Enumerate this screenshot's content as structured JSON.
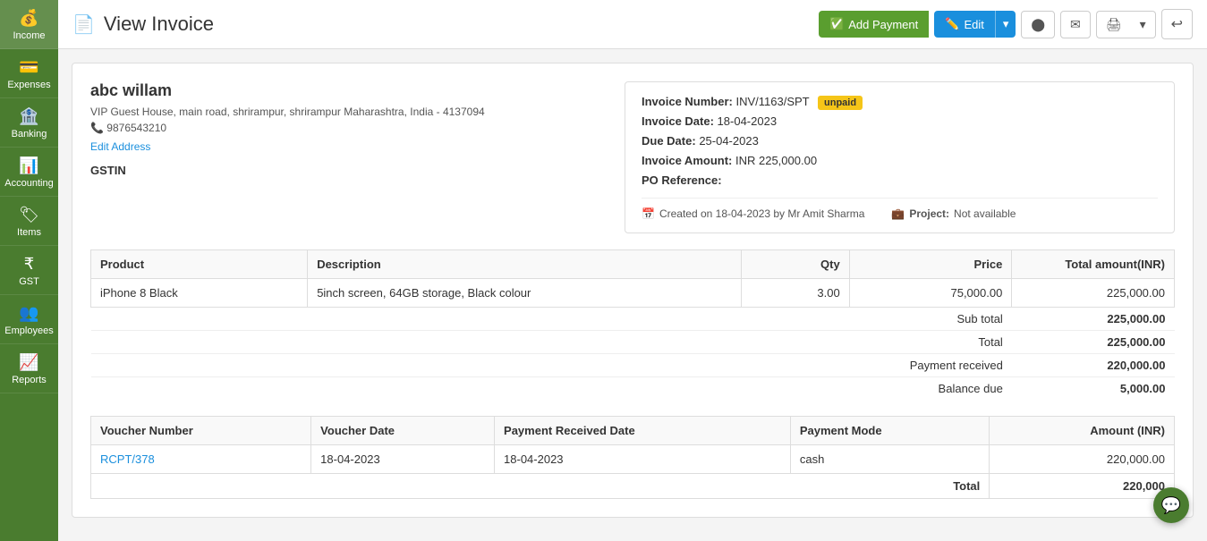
{
  "sidebar": {
    "items": [
      {
        "id": "income",
        "label": "Income",
        "icon": "💰"
      },
      {
        "id": "expenses",
        "label": "Expenses",
        "icon": "💳"
      },
      {
        "id": "banking",
        "label": "Banking",
        "icon": "🏦"
      },
      {
        "id": "accounting",
        "label": "Accounting",
        "icon": "📊"
      },
      {
        "id": "items",
        "label": "Items",
        "icon": "🏷"
      },
      {
        "id": "gst",
        "label": "GST",
        "icon": "₹"
      },
      {
        "id": "employees",
        "label": "Employees",
        "icon": "👥"
      },
      {
        "id": "reports",
        "label": "Reports",
        "icon": "📈"
      }
    ]
  },
  "header": {
    "page_icon": "📄",
    "title": "View Invoice",
    "buttons": {
      "add_payment": "Add Payment",
      "edit": "Edit",
      "back": "↩"
    }
  },
  "client": {
    "name": "abc willam",
    "address": "VIP Guest House, main road, shrirampur, shrirampur Maharashtra, India - 4137094",
    "phone": "9876543210",
    "edit_address": "Edit Address",
    "gstin_label": "GSTIN"
  },
  "invoice_meta": {
    "number_label": "Invoice Number:",
    "number_value": "INV/1163/SPT",
    "badge": "unpaid",
    "date_label": "Invoice Date:",
    "date_value": "18-04-2023",
    "due_label": "Due Date:",
    "due_value": "25-04-2023",
    "amount_label": "Invoice Amount:",
    "amount_value": "INR 225,000.00",
    "po_label": "PO Reference:",
    "po_value": ""
  },
  "created_bar": {
    "calendar_icon": "📅",
    "created_text": "Created on 18-04-2023 by Mr Amit Sharma",
    "briefcase_icon": "💼",
    "project_label": "Project:",
    "project_value": "Not available"
  },
  "product_table": {
    "columns": [
      "Product",
      "Description",
      "Qty",
      "Price",
      "Total amount(INR)"
    ],
    "rows": [
      {
        "product": "iPhone 8 Black",
        "description": "5inch screen, 64GB storage, Black colour",
        "qty": "3.00",
        "price": "75,000.00",
        "total": "225,000.00"
      }
    ],
    "sub_total_label": "Sub total",
    "sub_total_value": "225,000.00",
    "total_label": "Total",
    "total_value": "225,000.00",
    "payment_received_label": "Payment received",
    "payment_received_value": "220,000.00",
    "balance_due_label": "Balance due",
    "balance_due_value": "5,000.00"
  },
  "voucher_table": {
    "columns": [
      "Voucher Number",
      "Voucher Date",
      "Payment Received Date",
      "Payment Mode",
      "Amount (INR)"
    ],
    "rows": [
      {
        "voucher_number": "RCPT/378",
        "voucher_date": "18-04-2023",
        "payment_received_date": "18-04-2023",
        "payment_mode": "cash",
        "amount": "220,000.00"
      }
    ],
    "total_label": "Total",
    "total_value": "220,000"
  }
}
